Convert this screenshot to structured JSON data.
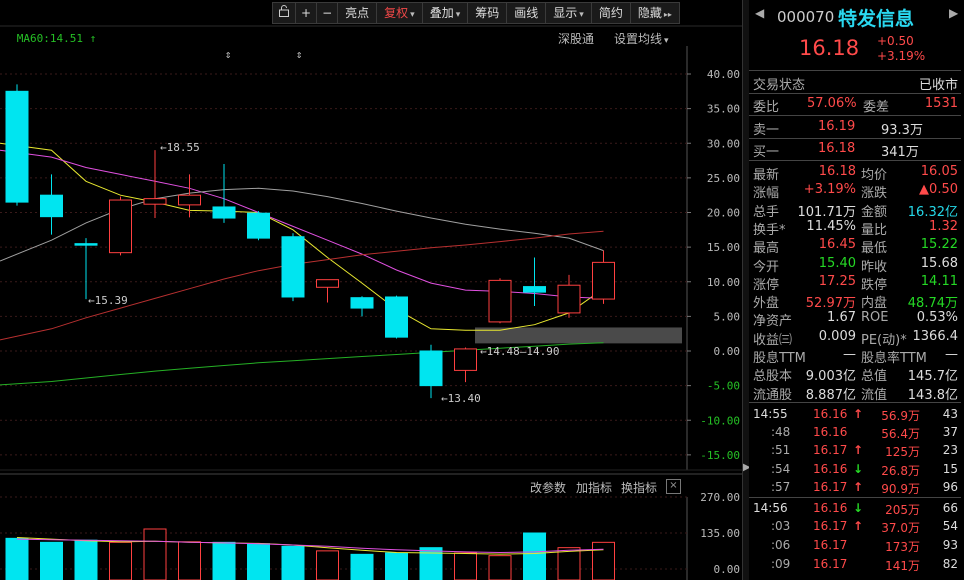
{
  "toolbar": {
    "items": [
      {
        "label": "",
        "icon": "lock-icon"
      },
      {
        "label": "+",
        "icon": "zoom-in-icon"
      },
      {
        "label": "−",
        "icon": "zoom-out-icon"
      },
      {
        "label": "亮点"
      },
      {
        "label": "复权",
        "active": true,
        "dropdown": true
      },
      {
        "label": "叠加",
        "dropdown": true
      },
      {
        "label": "筹码"
      },
      {
        "label": "画线"
      },
      {
        "label": "显示",
        "dropdown": true
      },
      {
        "label": "简约"
      },
      {
        "label": "隐藏",
        "suffix": "▸▸"
      }
    ]
  },
  "ma_label": {
    "prefix": "ㅤ",
    "text": "MA60:14.51",
    "arrow": "↑"
  },
  "chart_links": {
    "shgt": "深股通",
    "ma_settings": "设置均线"
  },
  "indicator_links": {
    "params": "改参数",
    "add": "加指标",
    "switch": "换指标",
    "close": "×"
  },
  "chart_data": {
    "type": "candlestick",
    "price_axis": {
      "ticks": [
        40.0,
        35.0,
        30.0,
        25.0,
        20.0,
        15.0,
        10.0,
        5.0,
        0.0,
        -5.0,
        -10.0,
        -15.0
      ],
      "range": [
        -17,
        42
      ]
    },
    "volume_axis": {
      "ticks": [
        270.0,
        135.0,
        0.0
      ]
    },
    "annotations": {
      "high": "18.55",
      "low1": "15.39",
      "low2": "13.40",
      "range": "14.48—14.90"
    },
    "candles": [
      {
        "o": 21.5,
        "c": 37.5,
        "h": 38.5,
        "l": 21.0,
        "dir": "down",
        "v": 115
      },
      {
        "o": 22.5,
        "c": 19.4,
        "h": 25.5,
        "l": 16.8,
        "dir": "down",
        "v": 100
      },
      {
        "o": 15.39,
        "c": 15.5,
        "h": 16.3,
        "l": 7.5,
        "dir": "down",
        "v": 108
      },
      {
        "o": 14.2,
        "c": 21.8,
        "h": 22.3,
        "l": 13.8,
        "dir": "up",
        "v": 100
      },
      {
        "o": 21.2,
        "c": 22.0,
        "h": 29.0,
        "l": 19.2,
        "dir": "up",
        "v": 150
      },
      {
        "o": 21.1,
        "c": 22.5,
        "h": 25.5,
        "l": 19.3,
        "dir": "up",
        "v": 102
      },
      {
        "o": 20.8,
        "c": 19.2,
        "h": 27.0,
        "l": 18.5,
        "dir": "down",
        "v": 100
      },
      {
        "o": 19.9,
        "c": 16.3,
        "h": 20.2,
        "l": 16.0,
        "dir": "down",
        "v": 95
      },
      {
        "o": 16.5,
        "c": 7.8,
        "h": 17.0,
        "l": 7.2,
        "dir": "down",
        "v": 85
      },
      {
        "o": 10.3,
        "c": 9.2,
        "h": 10.3,
        "l": 7.0,
        "dir": "up",
        "v": 68
      },
      {
        "o": 7.7,
        "c": 6.2,
        "h": 7.9,
        "l": 5.0,
        "dir": "down",
        "v": 55
      },
      {
        "o": 7.8,
        "c": 2.0,
        "h": 8.0,
        "l": 1.8,
        "dir": "down",
        "v": 60
      },
      {
        "o": 0.0,
        "c": -5.0,
        "h": 0.9,
        "l": -6.8,
        "dir": "down",
        "v": 80
      },
      {
        "o": -2.8,
        "c": 0.3,
        "h": 0.5,
        "l": -4.5,
        "dir": "up",
        "v": 60
      },
      {
        "o": 4.2,
        "c": 10.2,
        "h": 10.5,
        "l": 4.0,
        "dir": "up",
        "v": 50
      },
      {
        "o": 9.3,
        "c": 8.5,
        "h": 13.5,
        "l": 6.5,
        "dir": "down",
        "v": 135
      },
      {
        "o": 5.5,
        "c": 9.5,
        "h": 11.0,
        "l": 4.8,
        "dir": "up",
        "v": 80
      },
      {
        "o": 7.5,
        "c": 12.8,
        "h": 14.5,
        "l": 6.8,
        "dir": "up",
        "v": 100
      }
    ],
    "ma_series": [
      {
        "color": "#e8e830",
        "values": [
          30.0,
          29.0,
          24.5,
          22.5,
          21.5,
          20.3,
          20.2,
          20.0,
          17.5,
          13.5,
          9.8,
          6.0,
          3.2,
          3.0,
          3.0,
          3.8,
          5.5,
          9.0
        ]
      },
      {
        "color": "#e050e0",
        "values": [
          29.0,
          28.0,
          26.5,
          25.5,
          24.5,
          23.5,
          22.0,
          20.0,
          18.0,
          16.0,
          14.0,
          11.7,
          9.8,
          8.8,
          8.6,
          8.3,
          7.8,
          7.6
        ]
      },
      {
        "color": "#a0a0a0",
        "values": [
          13.0,
          16.0,
          18.5,
          20.5,
          22.0,
          22.8,
          23.3,
          23.5,
          23.1,
          22.3,
          21.3,
          20.2,
          19.2,
          18.3,
          17.6,
          17.0,
          16.3,
          14.5
        ]
      },
      {
        "color": "#b83030",
        "values": [
          1.6,
          3.2,
          4.8,
          6.2,
          7.6,
          9.0,
          10.4,
          11.6,
          12.5,
          13.2,
          13.9,
          14.4,
          14.9,
          15.3,
          15.8,
          16.3,
          16.9,
          17.3
        ]
      },
      {
        "color": "#25b025",
        "values": [
          -4.9,
          -4.4,
          -3.9,
          -3.4,
          -2.9,
          -2.5,
          -2.1,
          -1.7,
          -1.4,
          -1.1,
          -0.8,
          -0.5,
          -0.2,
          0.1,
          0.4,
          0.7,
          1.0,
          1.2
        ]
      }
    ],
    "volume_ma": [
      {
        "color": "#e8e830",
        "values": [
          118,
          112,
          106,
          102,
          104,
          100,
          98,
          96,
          90,
          80,
          70,
          62,
          60,
          58,
          56,
          58,
          66,
          72
        ]
      },
      {
        "color": "#e050e0",
        "values": [
          112,
          110,
          108,
          106,
          104,
          100,
          98,
          95,
          90,
          85,
          78,
          72,
          68,
          64,
          62,
          64,
          70,
          74
        ]
      }
    ]
  },
  "quote": {
    "code": "000070",
    "name": "特发信息",
    "price": "16.18",
    "change": "+0.50",
    "change_pct": "+3.19%",
    "status_label": "交易状态",
    "status_value": "已收市",
    "webi_label": "委比",
    "webi_value": "57.06%",
    "weicha_label": "委差",
    "weicha_value": "1531",
    "ask": {
      "label": "卖一",
      "price": "16.19",
      "vol": "93.3万"
    },
    "bid": {
      "label": "买一",
      "price": "16.18",
      "vol": "341万"
    },
    "stats": [
      [
        {
          "l": "最新",
          "v": "16.18",
          "c": "red"
        },
        {
          "l": "均价",
          "v": "16.05",
          "c": "red"
        }
      ],
      [
        {
          "l": "涨幅",
          "v": "+3.19%",
          "c": "red"
        },
        {
          "l": "涨跌",
          "v": "▲0.50",
          "c": "red"
        }
      ],
      [
        {
          "l": "总手",
          "v": "101.71万",
          "c": "wh"
        },
        {
          "l": "金额",
          "v": "16.32亿",
          "c": "cy"
        }
      ],
      [
        {
          "l": "换手*",
          "v": "11.45%",
          "c": "wh"
        },
        {
          "l": "量比",
          "v": "1.32",
          "c": "red"
        }
      ],
      [
        {
          "l": "最高",
          "v": "16.45",
          "c": "red"
        },
        {
          "l": "最低",
          "v": "15.22",
          "c": "grn"
        }
      ],
      [
        {
          "l": "今开",
          "v": "15.40",
          "c": "grn"
        },
        {
          "l": "昨收",
          "v": "15.68",
          "c": "wh"
        }
      ],
      [
        {
          "l": "涨停",
          "v": "17.25",
          "c": "red"
        },
        {
          "l": "跌停",
          "v": "14.11",
          "c": "grn"
        }
      ],
      [
        {
          "l": "外盘",
          "v": "52.97万",
          "c": "red"
        },
        {
          "l": "内盘",
          "v": "48.74万",
          "c": "grn"
        }
      ],
      [
        {
          "l": "净资产",
          "v": "1.67",
          "c": "wh"
        },
        {
          "l": "ROE",
          "v": "0.53%",
          "c": "wh"
        }
      ],
      [
        {
          "l": "收益㈢",
          "v": "0.009",
          "c": "wh"
        },
        {
          "l": "PE(动)*",
          "v": "1366.4",
          "c": "wh"
        }
      ],
      [
        {
          "l": "股息TTM",
          "v": "—",
          "c": "wh"
        },
        {
          "l": "股息率TTM",
          "v": "—",
          "c": "wh"
        }
      ],
      [
        {
          "l": "总股本",
          "v": "9.003亿",
          "c": "wh"
        },
        {
          "l": "总值",
          "v": "145.7亿",
          "c": "wh"
        }
      ],
      [
        {
          "l": "流通股",
          "v": "8.887亿",
          "c": "wh"
        },
        {
          "l": "流值",
          "v": "143.8亿",
          "c": "wh"
        }
      ]
    ],
    "ticks": [
      {
        "t": "14:55",
        "p": "16.16",
        "a": "↑",
        "ac": "red",
        "v": "56.9万",
        "n": "43"
      },
      {
        "t": ":48",
        "p": "16.16",
        "a": "",
        "ac": "",
        "v": "56.4万",
        "n": "37"
      },
      {
        "t": ":51",
        "p": "16.17",
        "a": "↑",
        "ac": "red",
        "v": "125万",
        "n": "23"
      },
      {
        "t": ":54",
        "p": "16.16",
        "a": "↓",
        "ac": "grn",
        "v": "26.8万",
        "n": "15"
      },
      {
        "t": ":57",
        "p": "16.17",
        "a": "↑",
        "ac": "red",
        "v": "90.9万",
        "n": "96"
      },
      {
        "t": "14:56",
        "p": "16.16",
        "a": "↓",
        "ac": "grn",
        "v": "205万",
        "n": "66"
      },
      {
        "t": ":03",
        "p": "16.17",
        "a": "↑",
        "ac": "red",
        "v": "37.0万",
        "n": "54"
      },
      {
        "t": ":06",
        "p": "16.17",
        "a": "",
        "ac": "",
        "v": "173万",
        "n": "93"
      },
      {
        "t": ":09",
        "p": "16.17",
        "a": "",
        "ac": "",
        "v": "141万",
        "n": "82"
      }
    ]
  }
}
